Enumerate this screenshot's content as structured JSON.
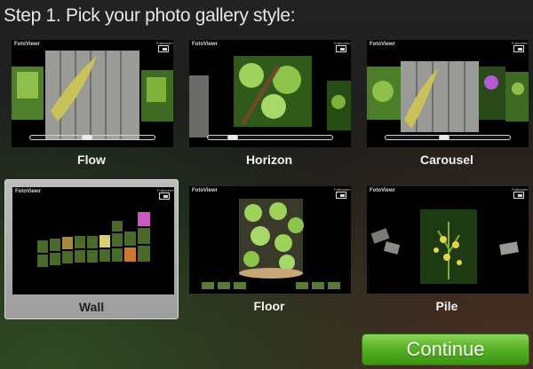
{
  "step_title": "Step 1. Pick your photo gallery style:",
  "styles": [
    {
      "label": "Flow",
      "brand": "FotoViewr",
      "fullscreen": "Fullscreen",
      "selected": false
    },
    {
      "label": "Horizon",
      "brand": "FotoViewr",
      "fullscreen": "Fullscreen",
      "selected": false
    },
    {
      "label": "Carousel",
      "brand": "FotoViewr",
      "fullscreen": "Fullscreen",
      "selected": false
    },
    {
      "label": "Wall",
      "brand": "FotoViewr",
      "fullscreen": "Fullscreen",
      "selected": true
    },
    {
      "label": "Floor",
      "brand": "FotoViewr",
      "fullscreen": "Fullscreen",
      "selected": false
    },
    {
      "label": "Pile",
      "brand": "FotoViewr",
      "fullscreen": "Fullscreen",
      "selected": false
    }
  ],
  "continue_label": "Continue",
  "colors": {
    "accent_green": "#57b226",
    "selected_card": "#bdbdbd"
  }
}
